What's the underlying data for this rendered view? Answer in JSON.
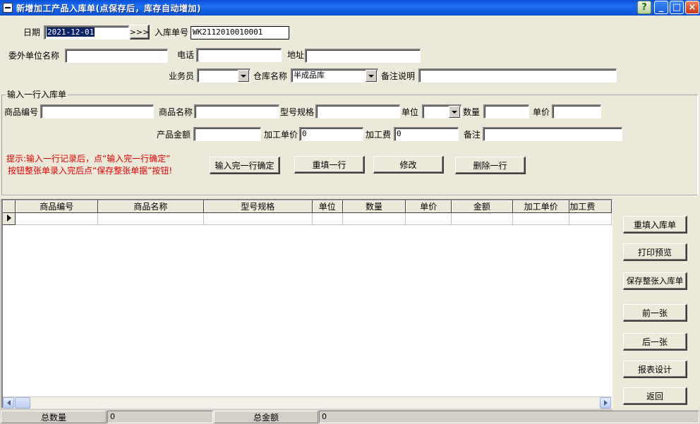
{
  "window": {
    "title": "新增加工产品入库单(点保存后，库存自动增加)",
    "buttons": {
      "help": "?",
      "minimize": "_",
      "maximize": "□",
      "close": "×"
    }
  },
  "header": {
    "date_label": "日期",
    "date_value": "2021-12-01",
    "date_picker_button": ">>>",
    "order_no_label": "入库单号",
    "order_no_value": "WK2112010010001",
    "contractor_label": "委外单位名称",
    "contractor_value": "",
    "phone_label": "电话",
    "phone_value": "",
    "address_label": "地址",
    "address_value": "",
    "salesman_label": "业务员",
    "salesman_value": "",
    "warehouse_label": "仓库名称",
    "warehouse_value": "半成品库",
    "remark_label": "备注说明",
    "remark_value": ""
  },
  "line_entry": {
    "group_title": "输入一行入库单",
    "product_code_label": "商品编号",
    "product_name_label": "商品名称",
    "spec_label": "型号规格",
    "unit_label": "单位",
    "quantity_label": "数量",
    "unit_price_label": "单价",
    "amount_label": "产品金额",
    "process_price_label": "加工单价",
    "process_price_value": "0",
    "process_fee_label": "加工费",
    "process_fee_value": "0",
    "note_label": "备注",
    "hint_line1": "提示:输入一行记录后，点“输入完一行确定”",
    "hint_line2": "按钮整张单录入完后点“保存整张单据”按钮!",
    "confirm_button": "输入完一行确定",
    "refill_row_button": "重填一行",
    "modify_button": "修改",
    "delete_row_button": "删除一行"
  },
  "grid": {
    "columns": [
      "商品编号",
      "商品名称",
      "型号规格",
      "单位",
      "数量",
      "单价",
      "金额",
      "加工单价",
      "加工费"
    ]
  },
  "side_buttons": {
    "refill_order": "重填入库单",
    "print_preview": "打印预览",
    "save_order": "保存整张入库单",
    "prev": "前一张",
    "next": "后一张",
    "report_design": "报表设计",
    "back": "返回"
  },
  "footer": {
    "total_qty_label": "总数量",
    "total_qty_value": "0",
    "total_amount_label": "总金额",
    "total_amount_value": "0"
  },
  "colors": {
    "titlebar": "#0a50d8",
    "form_background": "#ece9d8",
    "hint_text": "#e00000",
    "selection": "#0a246a"
  }
}
